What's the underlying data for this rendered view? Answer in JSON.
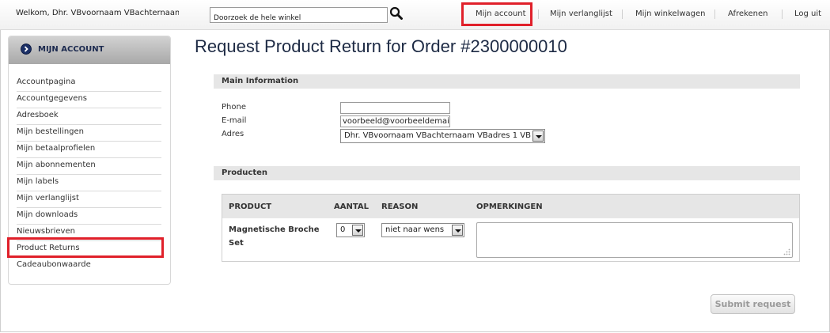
{
  "header": {
    "welcome": "Welkom, Dhr. VBvoornaam VBachternaam!",
    "search_placeholder": "Doorzoek de hele winkel",
    "nav": [
      "Mijn account",
      "Mijn verlanglijst",
      "Mijn winkelwagen",
      "Afrekenen",
      "Log uit"
    ]
  },
  "sidebar": {
    "title": "MIJN ACCOUNT",
    "items": [
      "Accountpagina",
      "Accountgegevens",
      "Adresboek",
      "Mijn bestellingen",
      "Mijn betaalprofielen",
      "Mijn abonnementen",
      "Mijn labels",
      "Mijn verlanglijst",
      "Mijn downloads",
      "Nieuwsbrieven",
      "Product Returns",
      "Cadeaubonwaarde"
    ],
    "highlighted_item": "Product Returns"
  },
  "main": {
    "title": "Request Product Return for Order #2300000010",
    "main_info": {
      "heading": "Main Information",
      "phone_label": "Phone",
      "phone_value": "",
      "email_label": "E-mail",
      "email_value": "voorbeeld@voorbeeldemaila",
      "address_label": "Adres",
      "address_value": "Dhr. VBvoornaam VBachternaam VBadres 1 VB"
    },
    "products": {
      "heading": "Producten",
      "columns": [
        "PRODUCT",
        "AANTAL",
        "REASON",
        "OPMERKINGEN"
      ],
      "rows": [
        {
          "product": "Magnetische Broche Set",
          "quantity": "0",
          "reason": "niet naar wens",
          "remarks": ""
        }
      ]
    },
    "submit_label": "Submit request"
  },
  "colors": {
    "highlight": "#e0202a",
    "title": "#1d2a44",
    "section_bg": "#e6e6e6"
  }
}
